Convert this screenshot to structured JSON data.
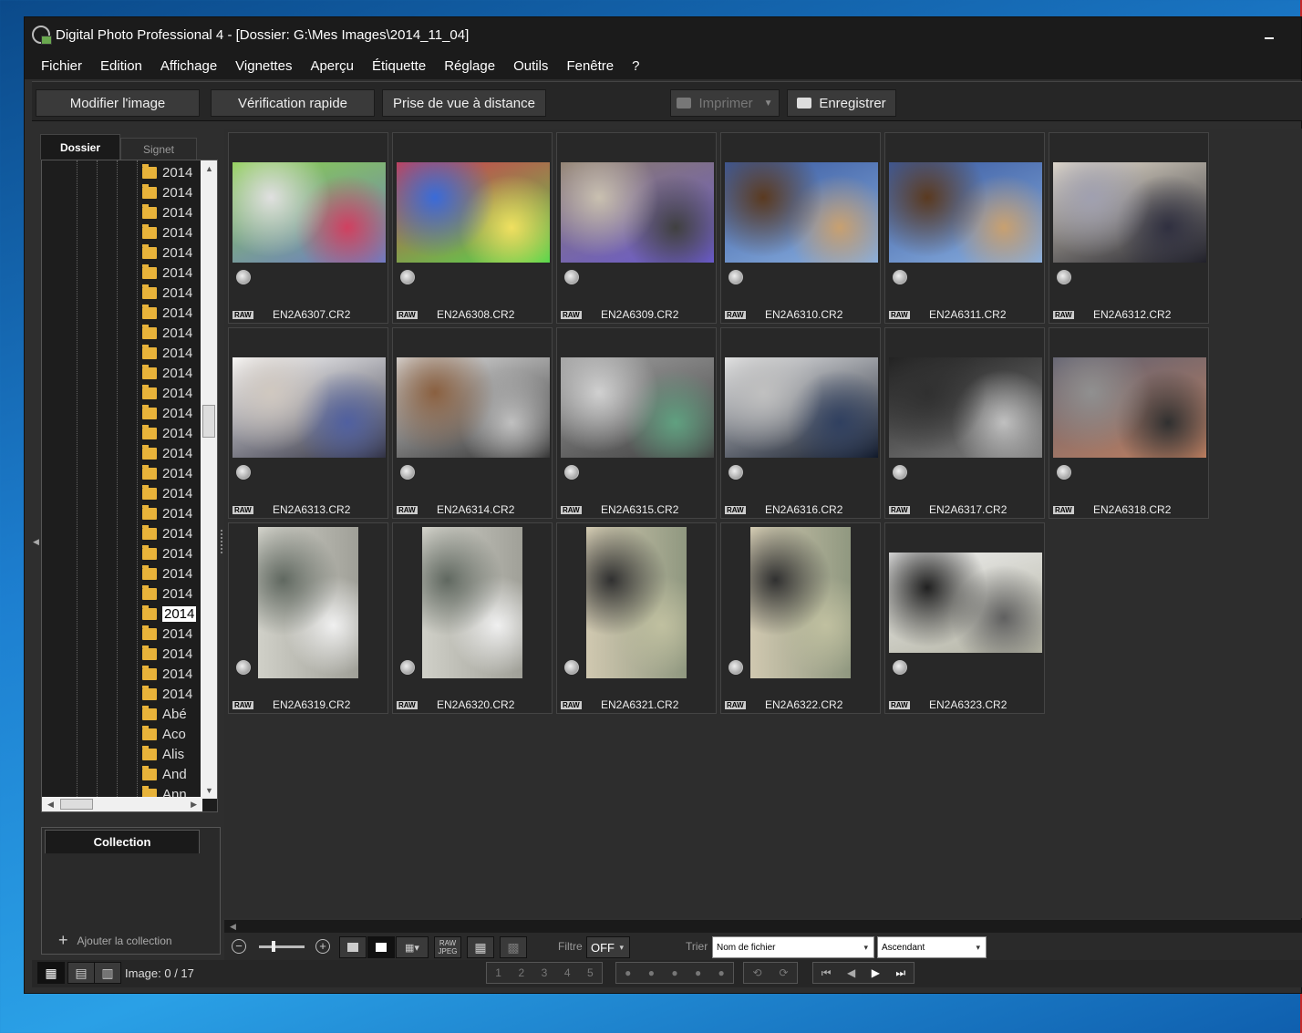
{
  "window": {
    "title": "Digital Photo Professional 4 - [Dossier: G:\\Mes Images\\2014_11_04]"
  },
  "menu": [
    "Fichier",
    "Edition",
    "Affichage",
    "Vignettes",
    "Aperçu",
    "Étiquette",
    "Réglage",
    "Outils",
    "Fenêtre",
    "?"
  ],
  "toolbar": {
    "edit_image": "Modifier l'image",
    "quick_check": "Vérification rapide",
    "remote_shooting": "Prise de vue à distance",
    "print": "Imprimer",
    "save": "Enregistrer"
  },
  "left_panel": {
    "tabs": [
      "Dossier",
      "Signet"
    ],
    "folders": [
      "2014",
      "2014",
      "2014",
      "2014",
      "2014",
      "2014",
      "2014",
      "2014",
      "2014",
      "2014",
      "2014",
      "2014",
      "2014",
      "2014",
      "2014",
      "2014",
      "2014",
      "2014",
      "2014",
      "2014",
      "2014",
      "2014",
      "2014",
      "2014",
      "2014",
      "2014",
      "2014",
      "Abé",
      "Aco",
      "Alis",
      "And",
      "Ann"
    ],
    "selected_index": 22
  },
  "collection": {
    "title": "Collection",
    "add_label": "Ajouter la collection"
  },
  "thumbnails": {
    "raw_badge": "RAW",
    "items": [
      {
        "file": "EN2A6307.CR2",
        "colors": [
          "#8ad04a",
          "#6c7cc7",
          "#e0e0e0",
          "#d04060"
        ],
        "portrait": false
      },
      {
        "file": "EN2A6308.CR2",
        "colors": [
          "#d33a4e",
          "#53d94b",
          "#3a6bd8",
          "#f0e060"
        ],
        "portrait": false
      },
      {
        "file": "EN2A6309.CR2",
        "colors": [
          "#8a7a6a",
          "#6a5ad0",
          "#c9c0b0",
          "#404040"
        ],
        "portrait": false
      },
      {
        "file": "EN2A6310.CR2",
        "colors": [
          "#3a5aa0",
          "#8ab0e0",
          "#5a3a20",
          "#c8a070"
        ],
        "portrait": false
      },
      {
        "file": "EN2A6311.CR2",
        "colors": [
          "#3a5aa0",
          "#8ab0e0",
          "#5a3a20",
          "#c8a070"
        ],
        "portrait": false
      },
      {
        "file": "EN2A6312.CR2",
        "colors": [
          "#e8e0d0",
          "#202028",
          "#a0a0b0",
          "#303040"
        ],
        "portrait": false
      },
      {
        "file": "EN2A6313.CR2",
        "colors": [
          "#ffffff",
          "#303040",
          "#d0c8c0",
          "#5060a0"
        ],
        "portrait": false
      },
      {
        "file": "EN2A6314.CR2",
        "colors": [
          "#e0e0e0",
          "#303030",
          "#8a6040",
          "#c0c0c0"
        ],
        "portrait": false
      },
      {
        "file": "EN2A6315.CR2",
        "colors": [
          "#a0a0a0",
          "#404040",
          "#d0d0d0",
          "#60a080"
        ],
        "portrait": false
      },
      {
        "file": "EN2A6316.CR2",
        "colors": [
          "#e8e8e8",
          "#101828",
          "#c0c0c0",
          "#304060"
        ],
        "portrait": false
      },
      {
        "file": "EN2A6317.CR2",
        "colors": [
          "#202020",
          "#808080",
          "#303030",
          "#c0c0c0"
        ],
        "portrait": false
      },
      {
        "file": "EN2A6318.CR2",
        "colors": [
          "#606070",
          "#c08060",
          "#909090",
          "#303030"
        ],
        "portrait": false
      },
      {
        "file": "EN2A6319.CR2",
        "colors": [
          "#d0d0c8",
          "#a0a098",
          "#606860",
          "#f0f0f0"
        ],
        "portrait": true
      },
      {
        "file": "EN2A6320.CR2",
        "colors": [
          "#d0d0c8",
          "#a0a098",
          "#606860",
          "#f0f0f0"
        ],
        "portrait": true
      },
      {
        "file": "EN2A6321.CR2",
        "colors": [
          "#d0c8b0",
          "#909880",
          "#303030",
          "#c0c0a0"
        ],
        "portrait": true
      },
      {
        "file": "EN2A6322.CR2",
        "colors": [
          "#d0c8b0",
          "#909880",
          "#303030",
          "#c0c0a0"
        ],
        "portrait": true
      },
      {
        "file": "EN2A6323.CR2",
        "colors": [
          "#f0f0f0",
          "#b0b0a0",
          "#202020",
          "#606060"
        ],
        "portrait": false
      }
    ]
  },
  "bottom": {
    "filter_label": "Filtre",
    "filter_value": "OFF",
    "sort_label": "Trier",
    "sort_value": "Nom de fichier",
    "order_value": "Ascendant",
    "raw_label": "RAW",
    "jpeg_label": "JPEG"
  },
  "status": {
    "image_count": "Image: 0 / 17",
    "ratings": [
      "1",
      "2",
      "3",
      "4",
      "5"
    ]
  }
}
